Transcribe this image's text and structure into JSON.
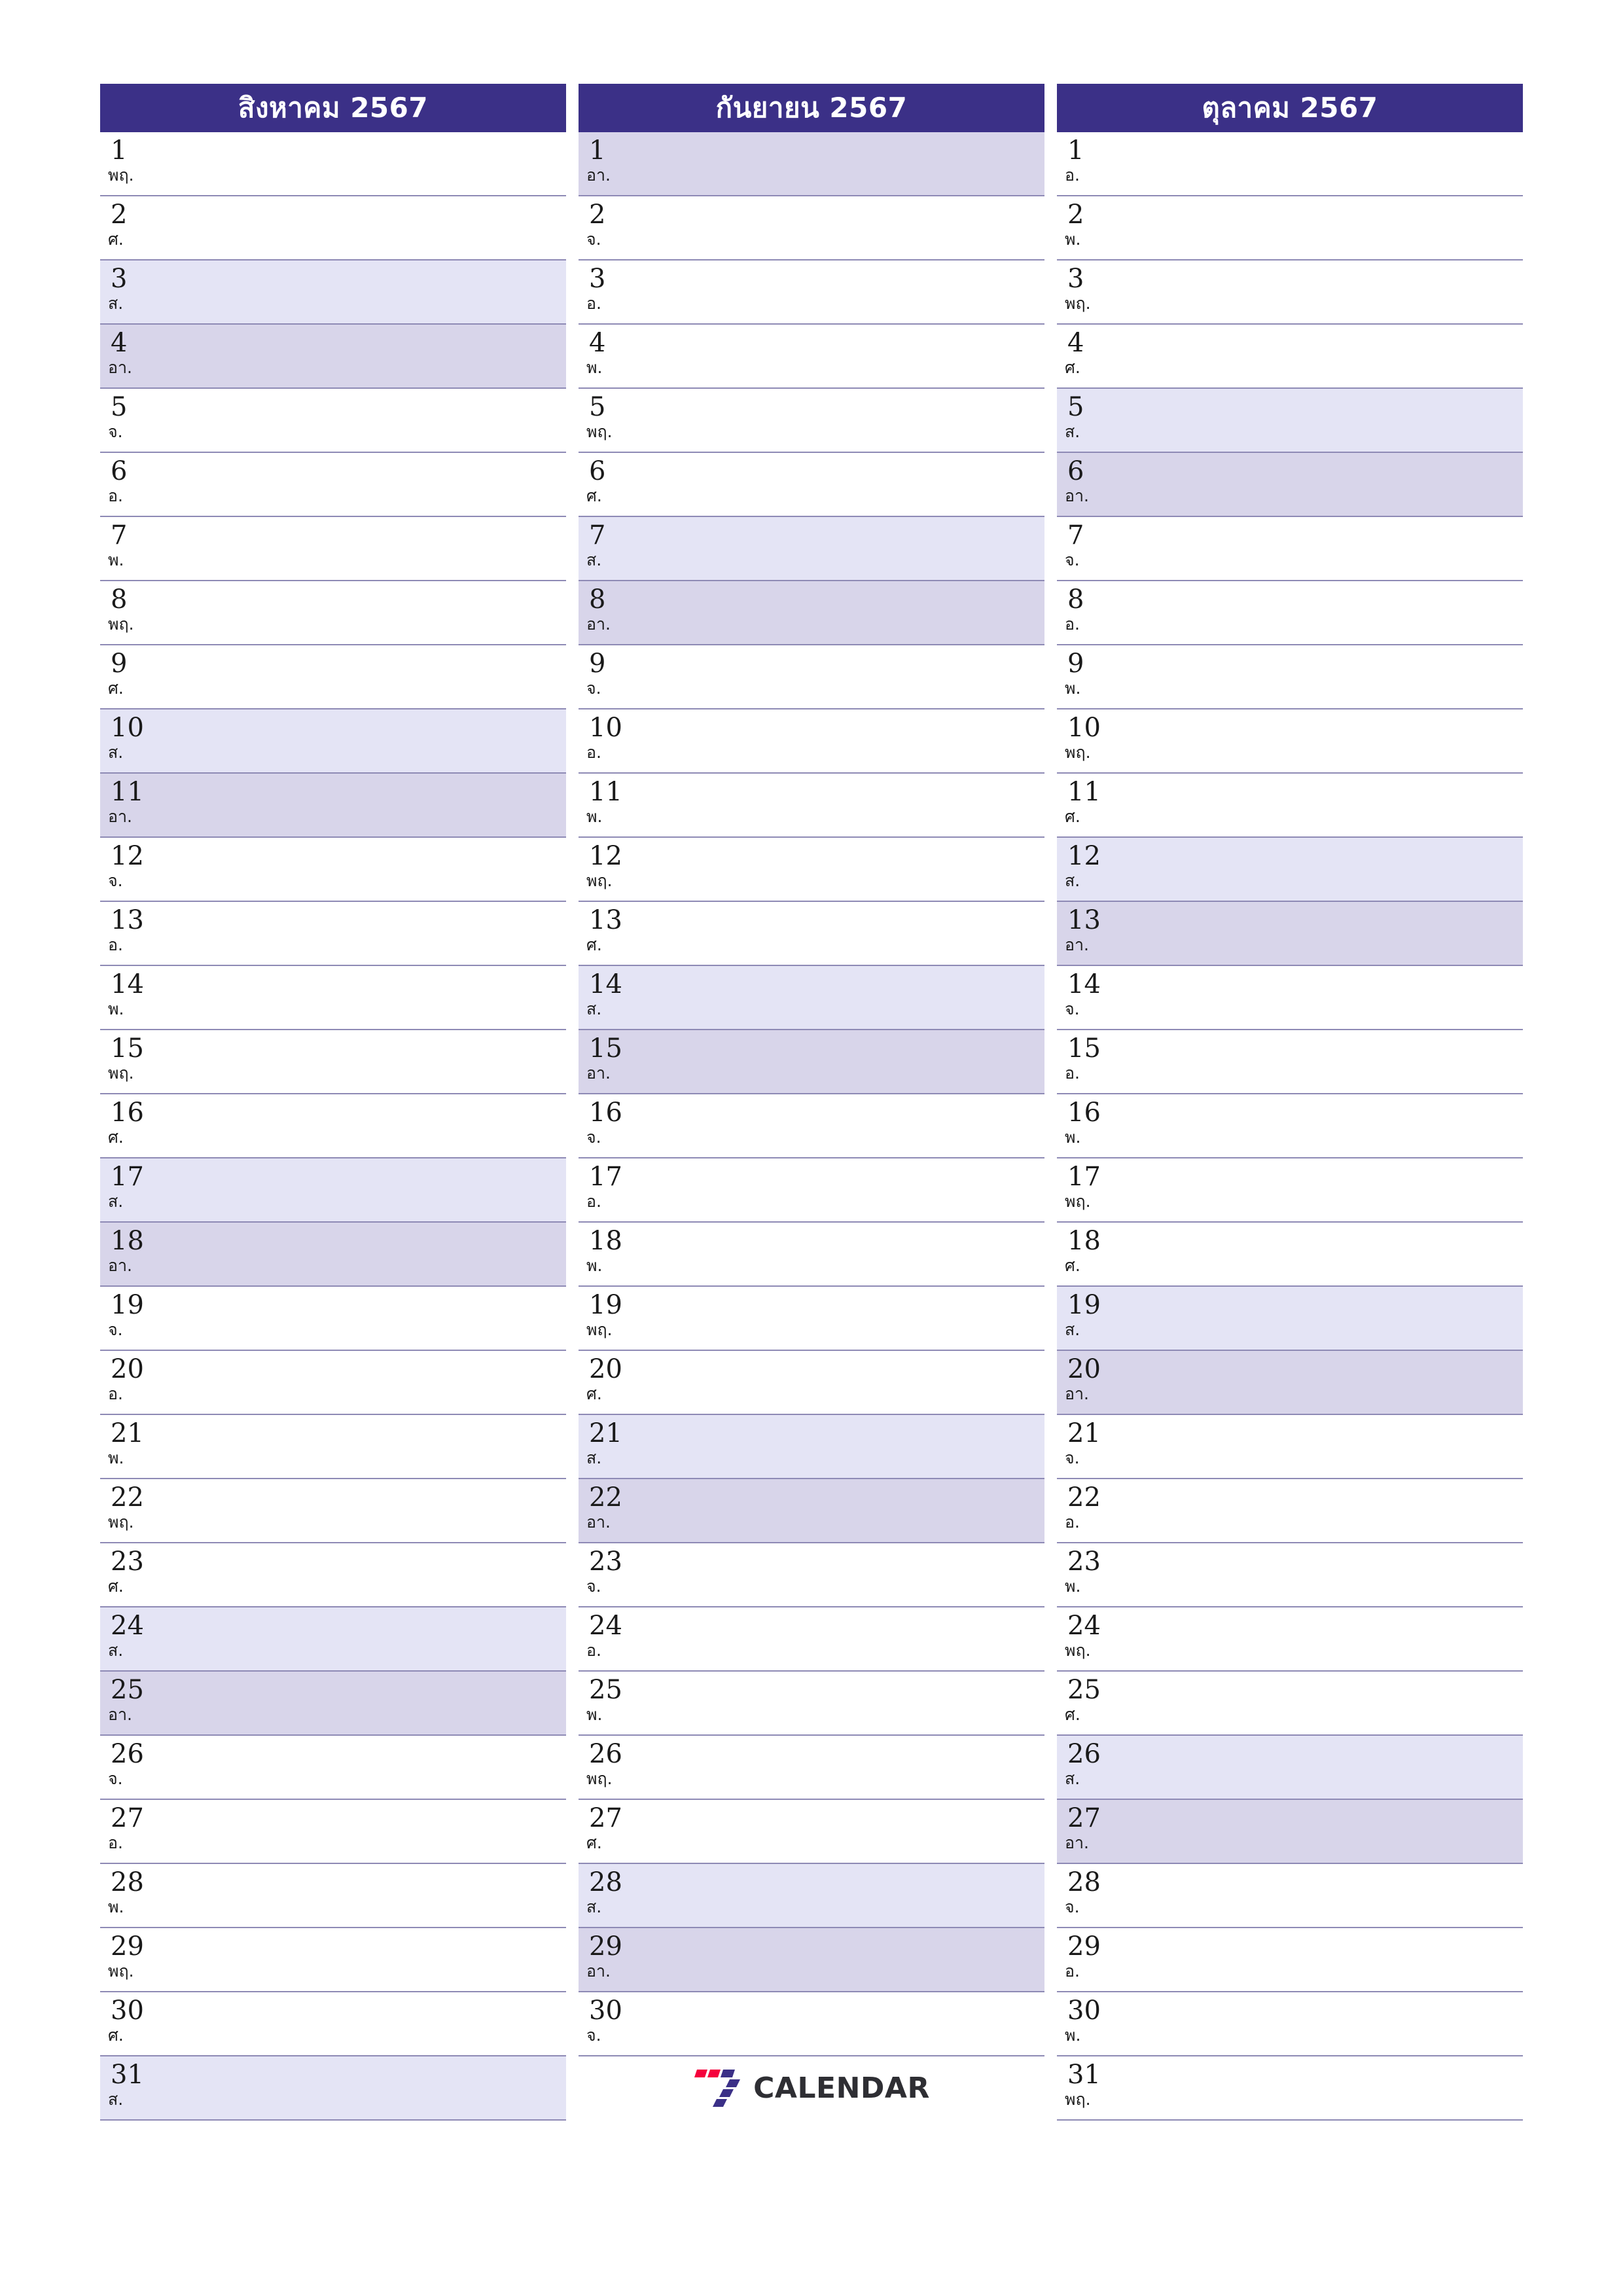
{
  "colors": {
    "header_bg": "#3b3087",
    "header_text": "#ffffff",
    "saturday_bg": "#e4e4f5",
    "sunday_bg": "#d8d5ea",
    "row_border": "#8e8ab5",
    "logo_red": "#f5003c",
    "logo_purple": "#3b3087",
    "logo_text": "#2e2e33"
  },
  "logo": {
    "text": "CALENDAR",
    "mark": "seven-logo-mark"
  },
  "months": [
    {
      "title": "สิงหาคม 2567",
      "days": [
        {
          "num": "1",
          "name": "พฤ.",
          "type": "weekday"
        },
        {
          "num": "2",
          "name": "ศ.",
          "type": "weekday"
        },
        {
          "num": "3",
          "name": "ส.",
          "type": "sat"
        },
        {
          "num": "4",
          "name": "อา.",
          "type": "sun"
        },
        {
          "num": "5",
          "name": "จ.",
          "type": "weekday"
        },
        {
          "num": "6",
          "name": "อ.",
          "type": "weekday"
        },
        {
          "num": "7",
          "name": "พ.",
          "type": "weekday"
        },
        {
          "num": "8",
          "name": "พฤ.",
          "type": "weekday"
        },
        {
          "num": "9",
          "name": "ศ.",
          "type": "weekday"
        },
        {
          "num": "10",
          "name": "ส.",
          "type": "sat"
        },
        {
          "num": "11",
          "name": "อา.",
          "type": "sun"
        },
        {
          "num": "12",
          "name": "จ.",
          "type": "weekday"
        },
        {
          "num": "13",
          "name": "อ.",
          "type": "weekday"
        },
        {
          "num": "14",
          "name": "พ.",
          "type": "weekday"
        },
        {
          "num": "15",
          "name": "พฤ.",
          "type": "weekday"
        },
        {
          "num": "16",
          "name": "ศ.",
          "type": "weekday"
        },
        {
          "num": "17",
          "name": "ส.",
          "type": "sat"
        },
        {
          "num": "18",
          "name": "อา.",
          "type": "sun"
        },
        {
          "num": "19",
          "name": "จ.",
          "type": "weekday"
        },
        {
          "num": "20",
          "name": "อ.",
          "type": "weekday"
        },
        {
          "num": "21",
          "name": "พ.",
          "type": "weekday"
        },
        {
          "num": "22",
          "name": "พฤ.",
          "type": "weekday"
        },
        {
          "num": "23",
          "name": "ศ.",
          "type": "weekday"
        },
        {
          "num": "24",
          "name": "ส.",
          "type": "sat"
        },
        {
          "num": "25",
          "name": "อา.",
          "type": "sun"
        },
        {
          "num": "26",
          "name": "จ.",
          "type": "weekday"
        },
        {
          "num": "27",
          "name": "อ.",
          "type": "weekday"
        },
        {
          "num": "28",
          "name": "พ.",
          "type": "weekday"
        },
        {
          "num": "29",
          "name": "พฤ.",
          "type": "weekday"
        },
        {
          "num": "30",
          "name": "ศ.",
          "type": "weekday"
        },
        {
          "num": "31",
          "name": "ส.",
          "type": "sat"
        }
      ],
      "trailing_logo": false
    },
    {
      "title": "กันยายน 2567",
      "days": [
        {
          "num": "1",
          "name": "อา.",
          "type": "sun"
        },
        {
          "num": "2",
          "name": "จ.",
          "type": "weekday"
        },
        {
          "num": "3",
          "name": "อ.",
          "type": "weekday"
        },
        {
          "num": "4",
          "name": "พ.",
          "type": "weekday"
        },
        {
          "num": "5",
          "name": "พฤ.",
          "type": "weekday"
        },
        {
          "num": "6",
          "name": "ศ.",
          "type": "weekday"
        },
        {
          "num": "7",
          "name": "ส.",
          "type": "sat"
        },
        {
          "num": "8",
          "name": "อา.",
          "type": "sun"
        },
        {
          "num": "9",
          "name": "จ.",
          "type": "weekday"
        },
        {
          "num": "10",
          "name": "อ.",
          "type": "weekday"
        },
        {
          "num": "11",
          "name": "พ.",
          "type": "weekday"
        },
        {
          "num": "12",
          "name": "พฤ.",
          "type": "weekday"
        },
        {
          "num": "13",
          "name": "ศ.",
          "type": "weekday"
        },
        {
          "num": "14",
          "name": "ส.",
          "type": "sat"
        },
        {
          "num": "15",
          "name": "อา.",
          "type": "sun"
        },
        {
          "num": "16",
          "name": "จ.",
          "type": "weekday"
        },
        {
          "num": "17",
          "name": "อ.",
          "type": "weekday"
        },
        {
          "num": "18",
          "name": "พ.",
          "type": "weekday"
        },
        {
          "num": "19",
          "name": "พฤ.",
          "type": "weekday"
        },
        {
          "num": "20",
          "name": "ศ.",
          "type": "weekday"
        },
        {
          "num": "21",
          "name": "ส.",
          "type": "sat"
        },
        {
          "num": "22",
          "name": "อา.",
          "type": "sun"
        },
        {
          "num": "23",
          "name": "จ.",
          "type": "weekday"
        },
        {
          "num": "24",
          "name": "อ.",
          "type": "weekday"
        },
        {
          "num": "25",
          "name": "พ.",
          "type": "weekday"
        },
        {
          "num": "26",
          "name": "พฤ.",
          "type": "weekday"
        },
        {
          "num": "27",
          "name": "ศ.",
          "type": "weekday"
        },
        {
          "num": "28",
          "name": "ส.",
          "type": "sat"
        },
        {
          "num": "29",
          "name": "อา.",
          "type": "sun"
        },
        {
          "num": "30",
          "name": "จ.",
          "type": "weekday"
        }
      ],
      "trailing_logo": true
    },
    {
      "title": "ตุลาคม 2567",
      "days": [
        {
          "num": "1",
          "name": "อ.",
          "type": "weekday"
        },
        {
          "num": "2",
          "name": "พ.",
          "type": "weekday"
        },
        {
          "num": "3",
          "name": "พฤ.",
          "type": "weekday"
        },
        {
          "num": "4",
          "name": "ศ.",
          "type": "weekday"
        },
        {
          "num": "5",
          "name": "ส.",
          "type": "sat"
        },
        {
          "num": "6",
          "name": "อา.",
          "type": "sun"
        },
        {
          "num": "7",
          "name": "จ.",
          "type": "weekday"
        },
        {
          "num": "8",
          "name": "อ.",
          "type": "weekday"
        },
        {
          "num": "9",
          "name": "พ.",
          "type": "weekday"
        },
        {
          "num": "10",
          "name": "พฤ.",
          "type": "weekday"
        },
        {
          "num": "11",
          "name": "ศ.",
          "type": "weekday"
        },
        {
          "num": "12",
          "name": "ส.",
          "type": "sat"
        },
        {
          "num": "13",
          "name": "อา.",
          "type": "sun"
        },
        {
          "num": "14",
          "name": "จ.",
          "type": "weekday"
        },
        {
          "num": "15",
          "name": "อ.",
          "type": "weekday"
        },
        {
          "num": "16",
          "name": "พ.",
          "type": "weekday"
        },
        {
          "num": "17",
          "name": "พฤ.",
          "type": "weekday"
        },
        {
          "num": "18",
          "name": "ศ.",
          "type": "weekday"
        },
        {
          "num": "19",
          "name": "ส.",
          "type": "sat"
        },
        {
          "num": "20",
          "name": "อา.",
          "type": "sun"
        },
        {
          "num": "21",
          "name": "จ.",
          "type": "weekday"
        },
        {
          "num": "22",
          "name": "อ.",
          "type": "weekday"
        },
        {
          "num": "23",
          "name": "พ.",
          "type": "weekday"
        },
        {
          "num": "24",
          "name": "พฤ.",
          "type": "weekday"
        },
        {
          "num": "25",
          "name": "ศ.",
          "type": "weekday"
        },
        {
          "num": "26",
          "name": "ส.",
          "type": "sat"
        },
        {
          "num": "27",
          "name": "อา.",
          "type": "sun"
        },
        {
          "num": "28",
          "name": "จ.",
          "type": "weekday"
        },
        {
          "num": "29",
          "name": "อ.",
          "type": "weekday"
        },
        {
          "num": "30",
          "name": "พ.",
          "type": "weekday"
        },
        {
          "num": "31",
          "name": "พฤ.",
          "type": "weekday"
        }
      ],
      "trailing_logo": false
    }
  ]
}
